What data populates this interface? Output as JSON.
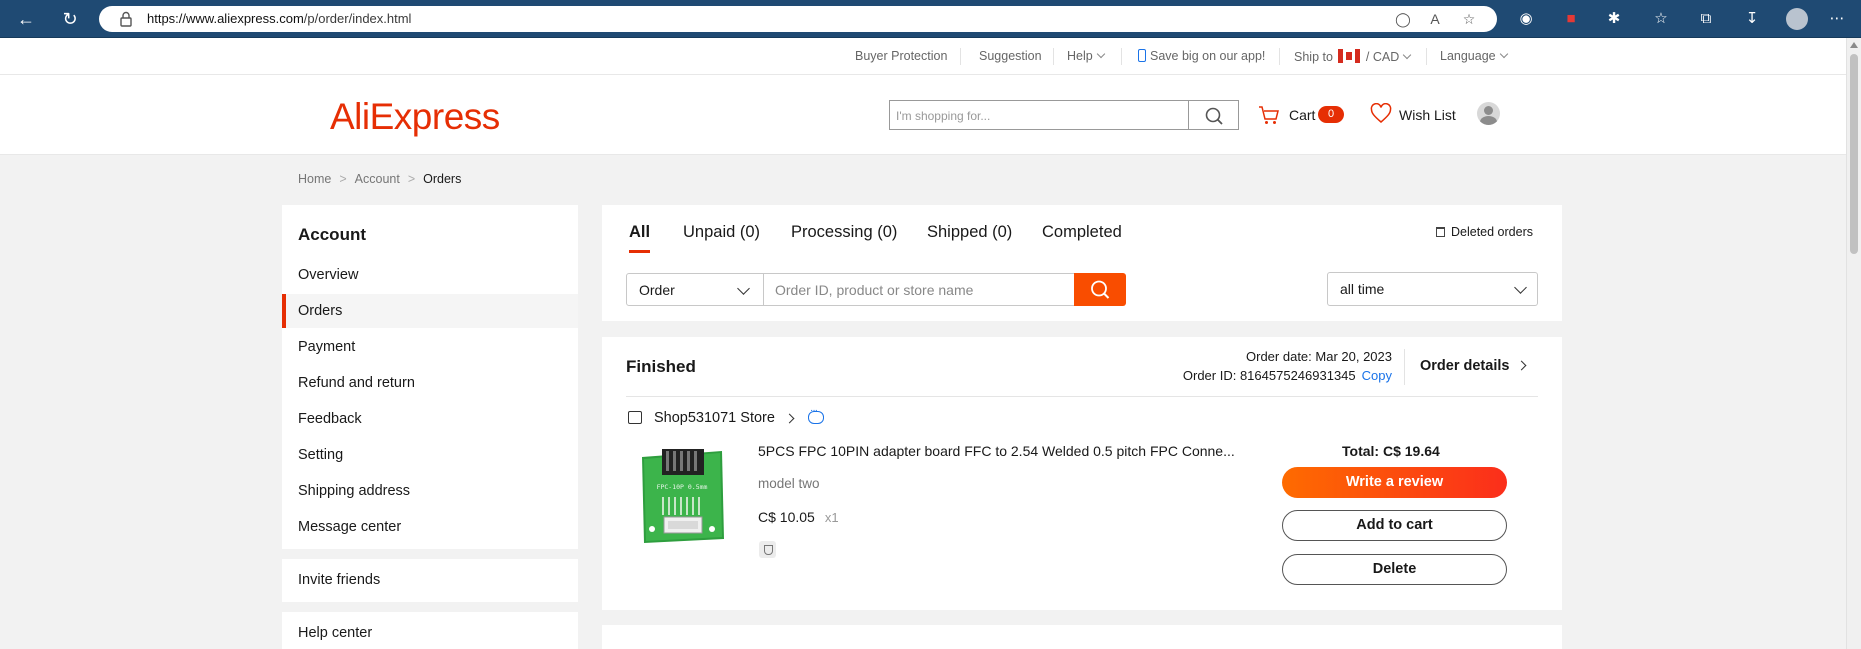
{
  "browser": {
    "url_host": "https://www.aliexpress.com",
    "url_path": "/p/order/index.html"
  },
  "top_links": {
    "buyer_protection": "Buyer Protection",
    "suggestion": "Suggestion",
    "help": "Help",
    "app_promo": "Save big on our app!",
    "ship_to": "Ship to",
    "currency": "CAD",
    "language": "Language"
  },
  "header": {
    "logo": "AliExpress",
    "search_placeholder": "I'm shopping for...",
    "cart_label": "Cart",
    "cart_count": "0",
    "wishlist_label": "Wish List"
  },
  "breadcrumb": [
    "Home",
    "Account",
    "Orders"
  ],
  "sidebar": {
    "title": "Account",
    "items": [
      {
        "label": "Overview"
      },
      {
        "label": "Orders"
      },
      {
        "label": "Payment"
      },
      {
        "label": "Refund and return"
      },
      {
        "label": "Feedback"
      },
      {
        "label": "Setting"
      },
      {
        "label": "Shipping address"
      },
      {
        "label": "Message center"
      },
      {
        "label": "Invite friends"
      },
      {
        "label": "Help center"
      }
    ],
    "active": "Orders"
  },
  "filters": {
    "tabs": [
      {
        "label": "All"
      },
      {
        "label": "Unpaid (0)"
      },
      {
        "label": "Processing (0)"
      },
      {
        "label": "Shipped (0)"
      },
      {
        "label": "Completed"
      }
    ],
    "active_tab": "All",
    "deleted_orders": "Deleted orders",
    "search_type": "Order",
    "search_placeholder": "Order ID, product or store name",
    "time_range": "all time"
  },
  "order": {
    "status": "Finished",
    "date_label": "Order date: Mar 20, 2023",
    "id_label": "Order ID: 8164575246931345",
    "copy": "Copy",
    "details": "Order details",
    "store": "Shop531071 Store",
    "product_title": "5PCS FPC 10PIN adapter board FFC to 2.54 Welded 0.5 pitch FPC Conne...",
    "variant": "model two",
    "price": "C$ 10.05",
    "quantity": "x1",
    "total": "Total: C$ 19.64",
    "actions": {
      "review": "Write a review",
      "add_to_cart": "Add to cart",
      "delete": "Delete"
    },
    "image_text": "FPC-10P 0.5mm"
  },
  "colors": {
    "brand": "#e62e04",
    "accent_button": "#f94d00",
    "link": "#1a73e8"
  }
}
